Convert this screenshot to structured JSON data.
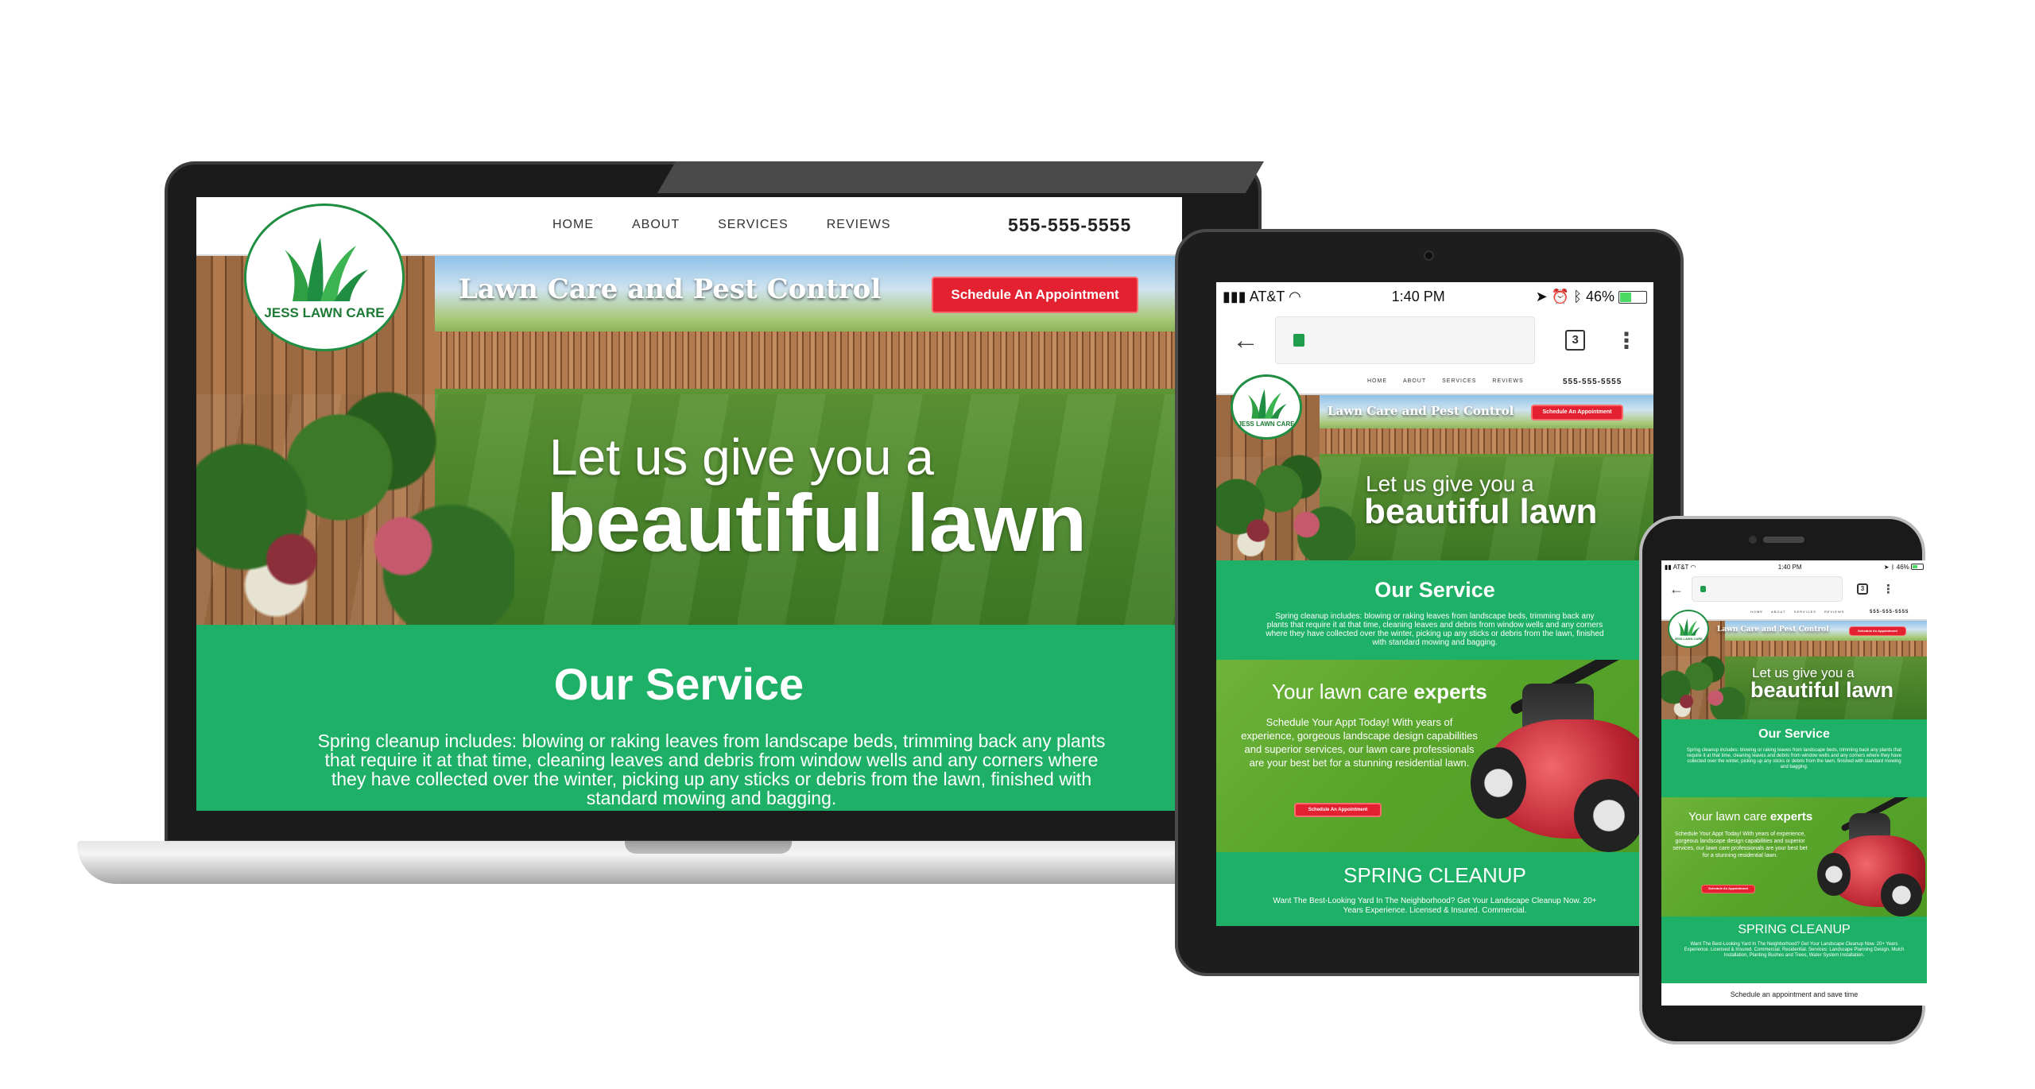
{
  "site": {
    "logo_text": "JESS LAWN CARE",
    "nav": [
      "HOME",
      "ABOUT",
      "SERVICES",
      "REVIEWS"
    ],
    "phone": "555-555-5555",
    "tagline": "Lawn Care and Pest Control",
    "cta": "Schedule An Appointment",
    "headline_line1": "Let us give you a",
    "headline_line2": "beautiful lawn",
    "service_title": "Our Service",
    "service_body": "Spring cleanup includes: blowing or raking leaves from landscape beds, trimming back any plants that require it at that time, cleaning leaves and debris from window wells and any corners where they have collected over the winter, picking up any sticks or debris from the lawn, finished with standard mowing and bagging.",
    "experts_title_pre": "Your lawn care",
    "experts_title_strong": "experts",
    "experts_body": "Schedule Your Appt Today! With years of experience, gorgeous landscape design capabilities and superior services, our lawn care professionals are your best bet for a stunning residential lawn.",
    "spring_title": "SPRING CLEANUP",
    "spring_body_tablet": "Want The Best-Looking Yard In The Neighborhood? Get Your Landscape Cleanup Now. 20+ Years Experience. Licensed & Insured. Commercial.",
    "spring_body_phone": "Want The Best-Looking Yard In The Neighborhood? Get Your Landscape Cleanup Now. 20+ Years Experience. Licensed & Insured. Commercial. Residential. Services: Landscape Planning Design, Mulch Installation, Planting Bushes and Trees, Water System Installation.",
    "footer_note": "Schedule an appointment and save time"
  },
  "mobile": {
    "carrier": "AT&T",
    "time": "1:40 PM",
    "battery": "46%",
    "tab_count": "3"
  },
  "colors": {
    "brand_green": "#1db066",
    "cta_red": "#e32130",
    "logo_green": "#1f8e43"
  },
  "icons": [
    "wifi-icon",
    "signal-icon",
    "location-icon",
    "alarm-icon",
    "bluetooth-icon",
    "battery-icon",
    "back-arrow-icon",
    "lock-icon",
    "tab-switcher-icon",
    "kebab-menu-icon",
    "grass-logo-icon"
  ]
}
